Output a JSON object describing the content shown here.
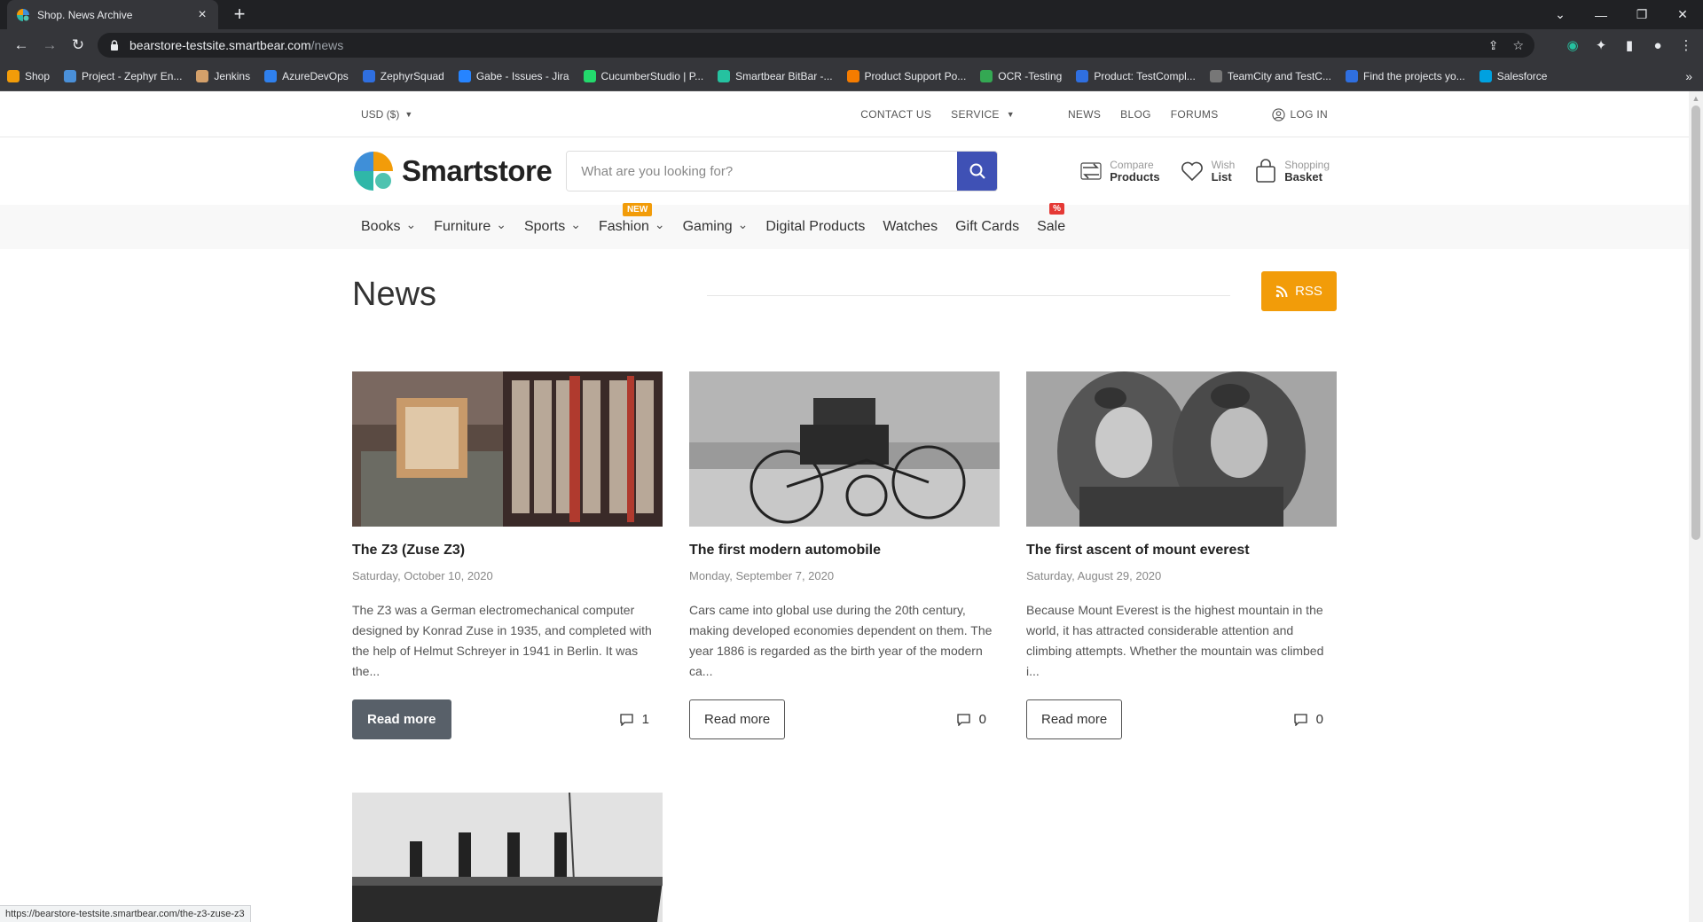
{
  "browser": {
    "tab_title": "Shop. News Archive",
    "url_host": "bearstore-testsite.smartbear.com",
    "url_path": "/news",
    "bookmarks": [
      {
        "label": "Shop",
        "color": "#f29c09"
      },
      {
        "label": "Project - Zephyr En...",
        "color": "#4a90d9"
      },
      {
        "label": "Jenkins",
        "color": "#d4a06a"
      },
      {
        "label": "AzureDevOps",
        "color": "#2f80ed"
      },
      {
        "label": "ZephyrSquad",
        "color": "#2f6fe0"
      },
      {
        "label": "Gabe - Issues - Jira",
        "color": "#2684ff"
      },
      {
        "label": "CucumberStudio | P...",
        "color": "#23d96c"
      },
      {
        "label": "Smartbear BitBar -...",
        "color": "#25c2a0"
      },
      {
        "label": "Product Support Po...",
        "color": "#f57c00"
      },
      {
        "label": "OCR -Testing",
        "color": "#34a853"
      },
      {
        "label": "Product: TestCompl...",
        "color": "#2f6fe0"
      },
      {
        "label": "TeamCity and TestC...",
        "color": "#777777"
      },
      {
        "label": "Find the projects yo...",
        "color": "#2f6fe0"
      },
      {
        "label": "Salesforce",
        "color": "#00a1e0"
      }
    ],
    "status_url": "https://bearstore-testsite.smartbear.com/the-z3-zuse-z3"
  },
  "topbar": {
    "currency": "USD  ($)",
    "contact": "CONTACT US",
    "service": "SERVICE",
    "news": "NEWS",
    "blog": "BLOG",
    "forums": "FORUMS",
    "login": "LOG IN"
  },
  "header": {
    "logo_text": "Smartstore",
    "search_placeholder": "What are you looking for?",
    "compare_l1": "Compare",
    "compare_l2": "Products",
    "wish_l1": "Wish",
    "wish_l2": "List",
    "basket_l1": "Shopping",
    "basket_l2": "Basket"
  },
  "categories": [
    {
      "label": "Books",
      "dropdown": true
    },
    {
      "label": "Furniture",
      "dropdown": true
    },
    {
      "label": "Sports",
      "dropdown": true
    },
    {
      "label": "Fashion",
      "dropdown": true,
      "badge": "NEW"
    },
    {
      "label": "Gaming",
      "dropdown": true
    },
    {
      "label": "Digital Products",
      "dropdown": false
    },
    {
      "label": "Watches",
      "dropdown": false
    },
    {
      "label": "Gift Cards",
      "dropdown": false
    },
    {
      "label": "Sale",
      "dropdown": false,
      "badge": "%"
    }
  ],
  "page": {
    "title": "News",
    "rss_label": "RSS"
  },
  "news": [
    {
      "title": "The Z3 (Zuse Z3)",
      "date": "Saturday, October 10, 2020",
      "excerpt": "The Z3 was a German electromechanical computer designed by Konrad Zuse in 1935, and completed with the help of Helmut Schreyer in 1941 in Berlin. It was the...",
      "read_more": "Read more",
      "comments": "1",
      "image": "z3-computer"
    },
    {
      "title": "The first modern automobile",
      "date": "Monday, September 7, 2020",
      "excerpt": "Cars came into global use during the 20th century, making developed economies dependent on them. The year 1886 is regarded as the birth year of the modern ca...",
      "read_more": "Read more",
      "comments": "0",
      "image": "benz-motorwagen"
    },
    {
      "title": "The first ascent of mount everest",
      "date": "Saturday, August 29, 2020",
      "excerpt": "Because Mount Everest is the highest mountain in the world, it has attracted considerable attention and climbing attempts. Whether the mountain was climbed i...",
      "read_more": "Read more",
      "comments": "0",
      "image": "everest-climbers"
    }
  ],
  "colors": {
    "accent_orange": "#f29c09",
    "search_blue": "#3f51b5",
    "sale_red": "#e53935"
  }
}
